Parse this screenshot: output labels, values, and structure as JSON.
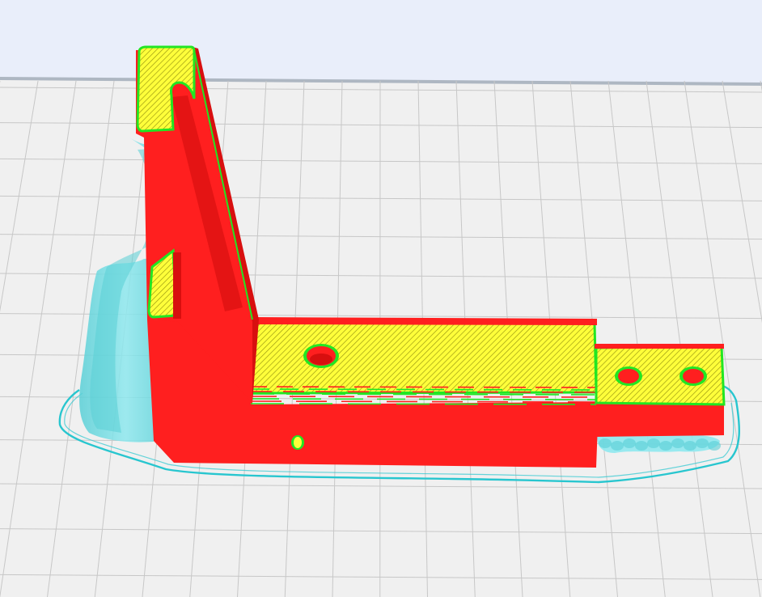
{
  "scene": {
    "colors": {
      "sky": "#e9eefa",
      "build_plate": "#f0f0f0",
      "grid_line": "#c7c7c7",
      "plate_edge": "#aeb7c2",
      "wall": "#ff1f1f",
      "wall_dark": "#d80f0f",
      "infill": "#ffff3a",
      "infill_hatch": "#9c9a12",
      "skin_outline": "#22e622",
      "support": "#8ee8ee",
      "support_dark": "#59cfd6",
      "skirt": "#28c6cf"
    },
    "icons": {
      "build_plate": "build-plate-grid-icon",
      "model": "layer-view-model-icon"
    }
  }
}
